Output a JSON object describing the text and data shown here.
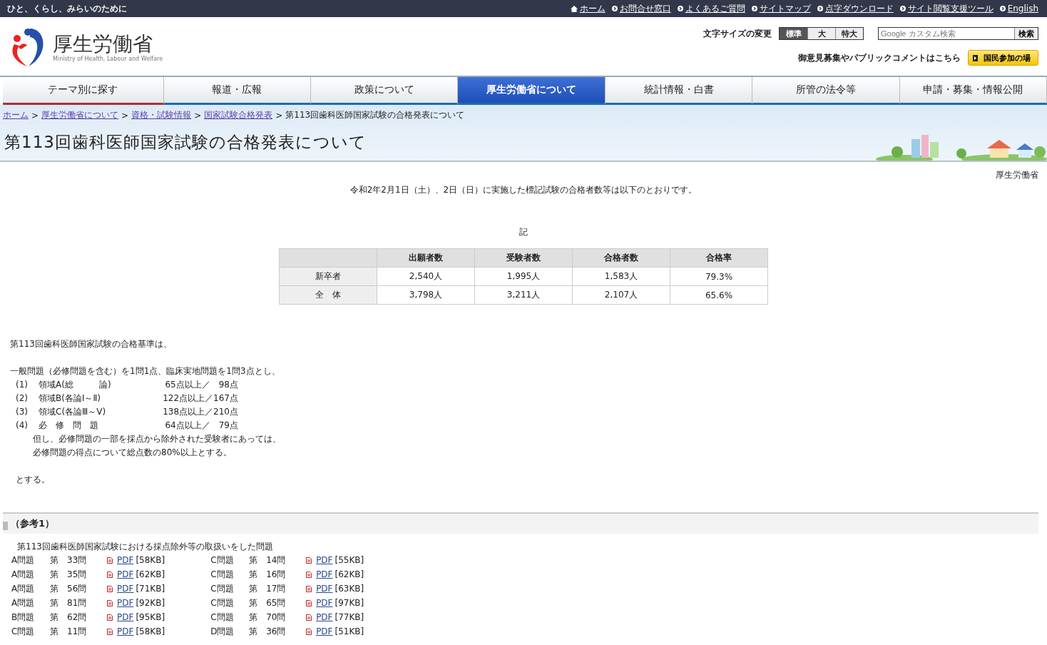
{
  "top_bar": {
    "tagline": "ひと、くらし、みらいのために",
    "links": [
      {
        "label": "ホーム",
        "kind": "home"
      },
      {
        "label": "お問合せ窓口",
        "kind": "link"
      },
      {
        "label": "よくあるご質問",
        "kind": "link"
      },
      {
        "label": "サイトマップ",
        "kind": "link"
      },
      {
        "label": "点字ダウンロード",
        "kind": "link"
      },
      {
        "label": "サイト閲覧支援ツール",
        "kind": "link"
      },
      {
        "label": "English",
        "kind": "link"
      }
    ]
  },
  "header": {
    "logo_title": "厚生労働省",
    "logo_subtitle": "Ministry of Health, Labour and Welfare",
    "font_size_label": "文字サイズの変更",
    "font_sizes": [
      {
        "label": "標準",
        "selected": true
      },
      {
        "label": "大",
        "selected": false
      },
      {
        "label": "特大",
        "selected": false
      }
    ],
    "search": {
      "placeholder": "Google カスタム検索",
      "button": "検索"
    },
    "participation_text": "御意見募集やパブリックコメントはこちら",
    "participation_button": "国民参加の場"
  },
  "nav_tabs": [
    {
      "label": "テーマ別に探す",
      "selected": false
    },
    {
      "label": "報道・広報",
      "selected": false
    },
    {
      "label": "政策について",
      "selected": false
    },
    {
      "label": "厚生労働省について",
      "selected": true
    },
    {
      "label": "統計情報・白書",
      "selected": false
    },
    {
      "label": "所管の法令等",
      "selected": false
    },
    {
      "label": "申請・募集・情報公開",
      "selected": false
    }
  ],
  "breadcrumb": [
    {
      "label": "ホーム",
      "kind": "link"
    },
    {
      "label": ">",
      "kind": "separator"
    },
    {
      "label": "厚生労働省について",
      "kind": "link"
    },
    {
      "label": ">",
      "kind": "separator"
    },
    {
      "label": "資格・試験情報",
      "kind": "link"
    },
    {
      "label": ">",
      "kind": "separator"
    },
    {
      "label": "国家試験合格発表",
      "kind": "link"
    },
    {
      "label": ">",
      "kind": "separator"
    },
    {
      "label": "第113回歯科医師国家試験の合格発表について",
      "kind": "current"
    }
  ],
  "page_title": "第113回歯科医師国家試験の合格発表について",
  "issuer": "厚生労働省",
  "intro": "令和2年2月1日（土）、2日（日）に実施した標記試験の合格者数等は以下のとおりです。",
  "ki": "記",
  "results_table": {
    "columns": [
      "出願者数",
      "受験者数",
      "合格者数",
      "合格率"
    ],
    "rows": [
      {
        "label": "新卒者",
        "cells": [
          "2,540人",
          "1,995人",
          "1,583人",
          "79.3%"
        ]
      },
      {
        "label": "全　体",
        "cells": [
          "3,798人",
          "3,211人",
          "2,107人",
          "65.6%"
        ]
      }
    ]
  },
  "criteria_heading": "第113回歯科医師国家試験の合格基準は、",
  "criteria_intro": "一般問題（必修問題を含む）を1問1点、臨床実地問題を1問3点とし、",
  "criteria": [
    {
      "number": "(1)",
      "area": "領域A(総　　　論)",
      "score": "65点以上／　98点"
    },
    {
      "number": "(2)",
      "area": "領域B(各論Ⅰ～Ⅱ)",
      "score": "122点以上／167点"
    },
    {
      "number": "(3)",
      "area": "領域C(各論Ⅲ～Ⅴ)",
      "score": "138点以上／210点"
    },
    {
      "number": "(4)",
      "area": "必　修　問　題",
      "score": "64点以上／　79点"
    }
  ],
  "criteria_notes": [
    "但し、必修問題の一部を採点から除外された受験者にあっては、",
    "必修問題の得点について総点数の80%以上とする。"
  ],
  "criteria_end": "とする。",
  "reference": {
    "heading": "（参考1）",
    "caption": "第113回歯科医師国家試験における採点除外等の取扱いをした問題",
    "columns": [
      [
        {
          "group": "A問題",
          "number": "第　33問",
          "link": "PDF",
          "size": "[58KB]"
        },
        {
          "group": "A問題",
          "number": "第　35問",
          "link": "PDF",
          "size": "[62KB]"
        },
        {
          "group": "A問題",
          "number": "第　56問",
          "link": "PDF",
          "size": "[71KB]"
        },
        {
          "group": "A問題",
          "number": "第　81問",
          "link": "PDF",
          "size": "[92KB]"
        },
        {
          "group": "B問題",
          "number": "第　62問",
          "link": "PDF",
          "size": "[95KB]"
        },
        {
          "group": "C問題",
          "number": "第　11問",
          "link": "PDF",
          "size": "[58KB]"
        }
      ],
      [
        {
          "group": "C問題",
          "number": "第　14問",
          "link": "PDF",
          "size": "[55KB]"
        },
        {
          "group": "C問題",
          "number": "第　16問",
          "link": "PDF",
          "size": "[62KB]"
        },
        {
          "group": "C問題",
          "number": "第　17問",
          "link": "PDF",
          "size": "[63KB]"
        },
        {
          "group": "C問題",
          "number": "第　65問",
          "link": "PDF",
          "size": "[97KB]"
        },
        {
          "group": "C問題",
          "number": "第　70問",
          "link": "PDF",
          "size": "[77KB]"
        },
        {
          "group": "D問題",
          "number": "第　36問",
          "link": "PDF",
          "size": "[51KB]"
        }
      ]
    ]
  }
}
